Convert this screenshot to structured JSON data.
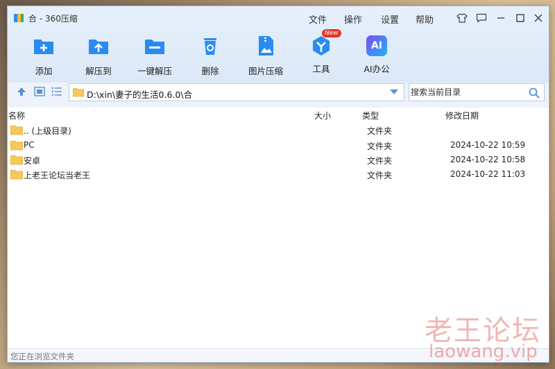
{
  "window": {
    "title": "合 - 360压缩",
    "menu": [
      "文件",
      "操作",
      "设置",
      "帮助"
    ]
  },
  "toolbar": [
    {
      "label": "添加",
      "icon": "add-folder-icon"
    },
    {
      "label": "解压到",
      "icon": "extract-to-icon"
    },
    {
      "label": "一键解压",
      "icon": "one-click-extract-icon"
    },
    {
      "label": "删除",
      "icon": "recycle-bin-icon"
    },
    {
      "label": "图片压缩",
      "icon": "image-compress-icon"
    },
    {
      "label": "工具",
      "icon": "tools-icon",
      "badge": "New"
    },
    {
      "label": "AI办公",
      "icon": "ai-office-icon",
      "glyph": "AI"
    }
  ],
  "address": {
    "path": "D:\\xin\\妻子的生活0.6.0\\合"
  },
  "search": {
    "placeholder": "搜索当前目录"
  },
  "columns": {
    "name": "名称",
    "size": "大小",
    "type": "类型",
    "date": "修改日期"
  },
  "files": [
    {
      "name": ".. (上级目录)",
      "type": "文件夹",
      "date": ""
    },
    {
      "name": "PC",
      "type": "文件夹",
      "date": "2024-10-22 10:59"
    },
    {
      "name": "安卓",
      "type": "文件夹",
      "date": "2024-10-22 10:58"
    },
    {
      "name": "上老王论坛当老王",
      "type": "文件夹",
      "date": "2024-10-22 11:03"
    }
  ],
  "status": "您正在浏览文件夹",
  "watermark": {
    "cn": "老王论坛",
    "en": "laowang.vip"
  },
  "colors": {
    "accent": "#2a8cf0",
    "folder": "#f7c95a",
    "badge": "#e5342b"
  }
}
